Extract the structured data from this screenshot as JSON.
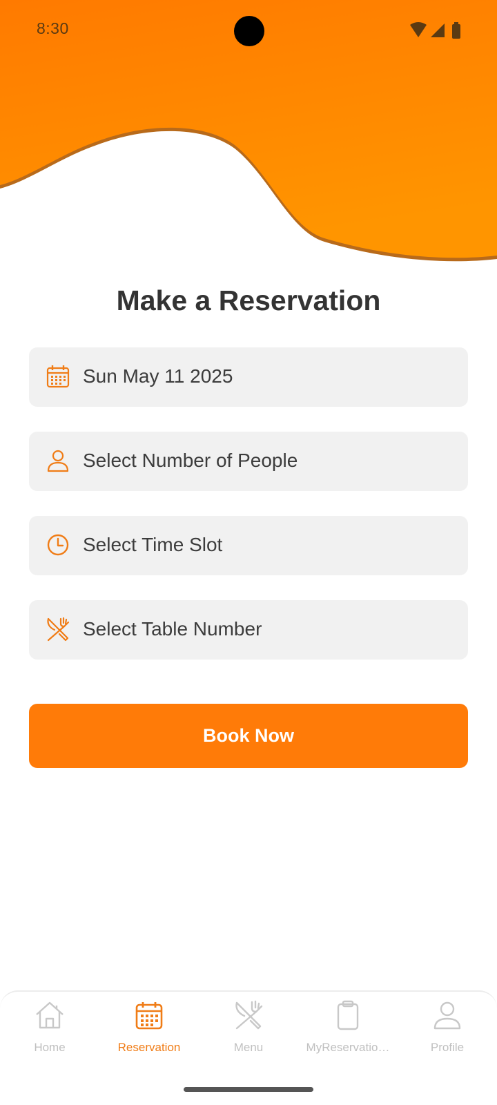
{
  "status_bar": {
    "time": "8:30",
    "icons": [
      "wifi-icon",
      "signal-icon",
      "battery-icon"
    ]
  },
  "colors": {
    "accent": "#ff7b08",
    "header_gradient_start": "#ff7a00",
    "header_gradient_end": "#ff9500",
    "field_background": "#f1f1f1",
    "inactive_nav": "#c0c0c0"
  },
  "page": {
    "title": "Make a Reservation"
  },
  "form": {
    "fields": [
      {
        "icon": "calendar-icon",
        "label": "Sun May 11 2025"
      },
      {
        "icon": "person-icon",
        "label": "Select Number of People"
      },
      {
        "icon": "clock-icon",
        "label": "Select Time Slot"
      },
      {
        "icon": "fork-knife-icon",
        "label": "Select Table Number"
      }
    ],
    "submit_label": "Book Now"
  },
  "bottom_nav": {
    "items": [
      {
        "icon": "home-icon",
        "label": "Home",
        "active": false
      },
      {
        "icon": "calendar-icon",
        "label": "Reservation",
        "active": true
      },
      {
        "icon": "fork-knife-icon",
        "label": "Menu",
        "active": false
      },
      {
        "icon": "clipboard-icon",
        "label": "MyReservatio…",
        "active": false
      },
      {
        "icon": "person-icon",
        "label": "Profile",
        "active": false
      }
    ]
  }
}
